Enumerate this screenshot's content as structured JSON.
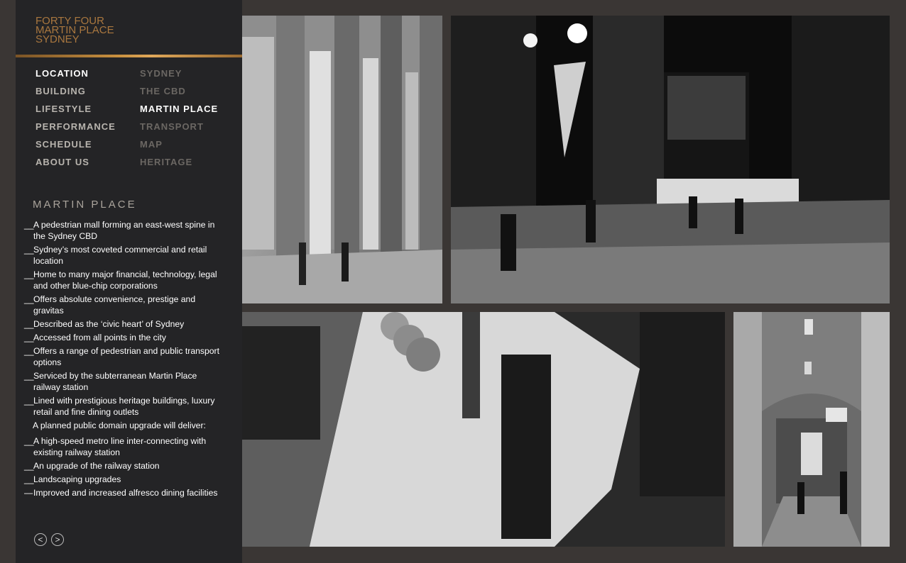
{
  "logo": {
    "lines": [
      "FORTY FOUR",
      "MARTIN PLACE",
      "SYDNEY"
    ]
  },
  "nav": {
    "primary": [
      {
        "label": "LOCATION",
        "active": true
      },
      {
        "label": "BUILDING"
      },
      {
        "label": "LIFESTYLE"
      },
      {
        "label": "PERFORMANCE"
      },
      {
        "label": "SCHEDULE"
      },
      {
        "label": "ABOUT US"
      }
    ],
    "secondary": [
      {
        "label": "SYDNEY"
      },
      {
        "label": "THE CBD"
      },
      {
        "label": "MARTIN PLACE",
        "active": true
      },
      {
        "label": "TRANSPORT"
      },
      {
        "label": "MAP"
      },
      {
        "label": "HERITAGE"
      }
    ]
  },
  "content": {
    "title": "MARTIN PLACE",
    "bullets": [
      "A pedestrian mall forming an east-west spine in the Sydney CBD",
      "Sydney’s most coveted commercial and retail location",
      "Home to many major financial, technology, legal and other blue-chip corporations",
      "Offers absolute convenience, prestige and gravitas",
      "Described as the ‘civic heart’ of Sydney",
      "Accessed from all points in the city",
      "Offers a range of pedestrian and public transport options",
      "Serviced by the subterranean Martin Place railway station",
      "Lined with prestigious heritage buildings, luxury retail and fine dining outlets"
    ],
    "intro": "A planned public domain upgrade will deliver:",
    "upgrades": [
      "A high-speed metro line inter-connecting with existing railway station",
      "An upgrade of the railway station",
      "Landscaping upgrades",
      "Improved and increased alfresco dining facilities"
    ]
  },
  "controls": {
    "prev": "<",
    "next": ">"
  },
  "colors": {
    "accent": "#b07a3c",
    "sidebar": "#242426",
    "background": "#3a3634"
  }
}
